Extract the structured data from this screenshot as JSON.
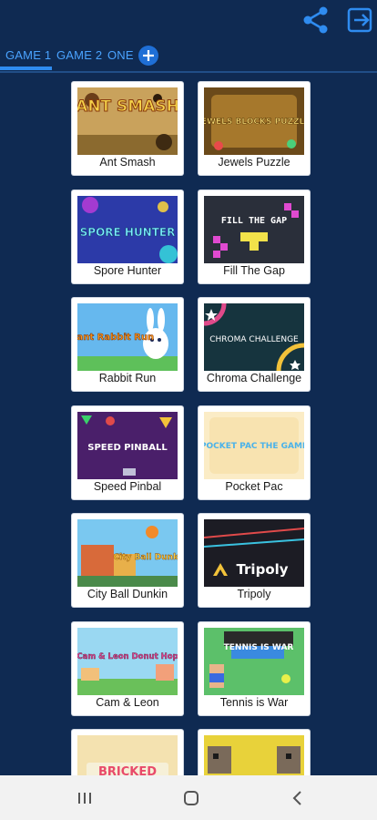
{
  "header": {
    "share_icon": "share-icon",
    "exit_icon": "exit-icon"
  },
  "tabs": [
    {
      "label": "GAME 1",
      "active": true
    },
    {
      "label": "GAME 2",
      "active": false
    },
    {
      "label": "ONE",
      "active": false
    }
  ],
  "add_tab_icon": "plus-icon",
  "games": [
    {
      "label": "Ant Smash",
      "thumb_text": "ANT SMASH"
    },
    {
      "label": "Jewels Puzzle",
      "thumb_text": "JEWELS BLOCKS PUZZLE"
    },
    {
      "label": "Spore Hunter",
      "thumb_text": "SPORE HUNTER"
    },
    {
      "label": "Fill The Gap",
      "thumb_text": "FILL THE GAP"
    },
    {
      "label": "Rabbit Run",
      "thumb_text": "Giant Rabbit Run"
    },
    {
      "label": "Chroma Challenge",
      "thumb_text": "CHROMA CHALLENGE"
    },
    {
      "label": "Speed Pinbal",
      "thumb_text": "SPEED PINBALL"
    },
    {
      "label": "Pocket Pac",
      "thumb_text": "POCKET PAC THE GAME"
    },
    {
      "label": "City Ball Dunkin",
      "thumb_text": "City Ball Dunkin"
    },
    {
      "label": "Tripoly",
      "thumb_text": "Tripoly"
    },
    {
      "label": "Cam & Leon",
      "thumb_text": "Cam & Leon Donut Hop"
    },
    {
      "label": "Tennis is War",
      "thumb_text": "TENNIS IS WAR"
    },
    {
      "label": "",
      "thumb_text": "BRICKED"
    },
    {
      "label": "",
      "thumb_text": ""
    }
  ],
  "nav": {
    "recent_icon": "recent-apps-icon",
    "home_icon": "home-icon",
    "back_icon": "back-icon"
  },
  "colors": {
    "background": "#0f2a52",
    "tab_text": "#4aa3ff",
    "tab_underline": "#2f8cf0",
    "accent": "#1f6fd6"
  }
}
